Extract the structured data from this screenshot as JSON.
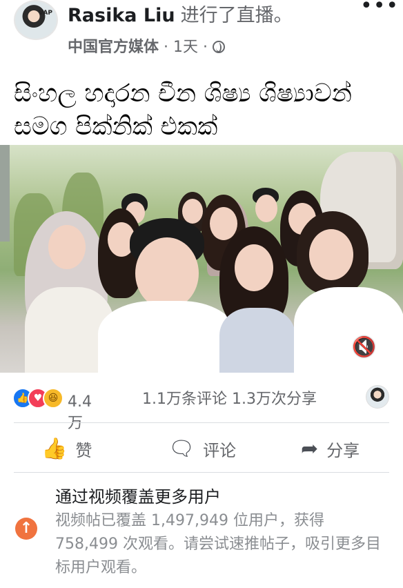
{
  "header": {
    "author": "Rasika Liu",
    "action": "进行了直播。",
    "avatar_tag": "VAP",
    "page_name": "中国官方媒体",
    "separator": "·",
    "time": "1天",
    "visibility_icon": "globe-icon",
    "more_icon": "more-options-icon",
    "more_glyph": "•••"
  },
  "post": {
    "text": "සිංහල හදාරන චීන ශිෂ්‍ය ශිෂ්‍යාවන් සමග පික්නික් එකක්"
  },
  "video": {
    "mute_icon": "speaker-muted-icon",
    "mute_glyph": "🔇"
  },
  "stats": {
    "reaction_icons": [
      "like-icon",
      "love-icon",
      "haha-icon"
    ],
    "reaction_count": "4.4万",
    "comments": "1.1万条评论",
    "shares": "1.3万次分享"
  },
  "actions": {
    "like_label": "赞",
    "comment_label": "评论",
    "share_label": "分享"
  },
  "boost": {
    "title": "通过视频覆盖更多用户",
    "description": "视频帖已覆盖 1,497,949 位用户，获得 758,499 次观看。请尝试速推帖子，吸引更多目标用户观看。",
    "icon": "arrow-up-icon"
  },
  "colors": {
    "accent": "#1877f2",
    "love": "#f33e58",
    "haha": "#f7b928",
    "boost": "#f0733f",
    "secondary_text": "#65676b"
  }
}
